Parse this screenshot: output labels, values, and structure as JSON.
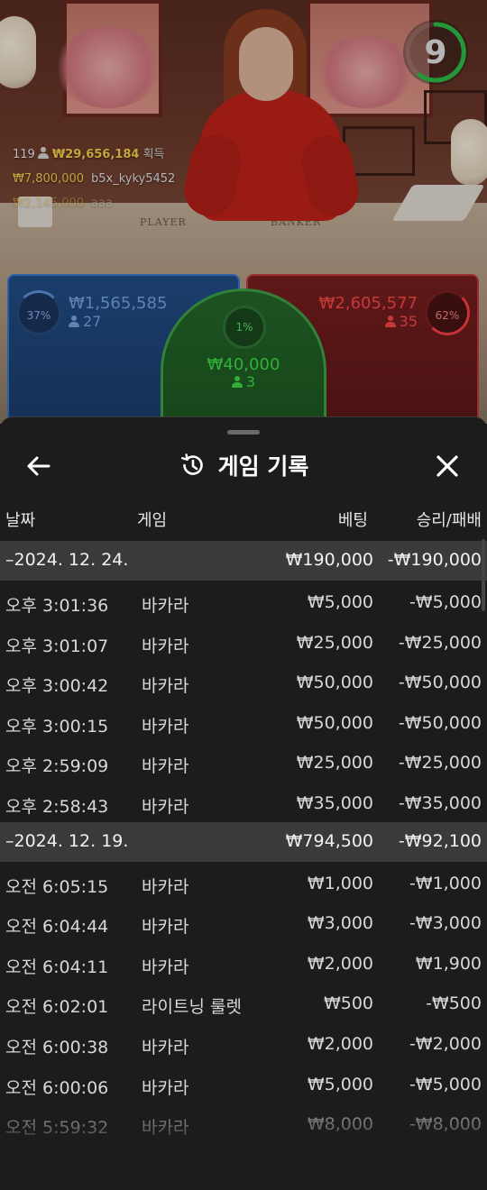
{
  "video": {
    "timer": "9",
    "felt_player": "PLAYER",
    "felt_banker": "BANKER",
    "winners": [
      {
        "count": "119",
        "amount": "₩29,656,184",
        "label": "획득"
      },
      {
        "amount": "₩7,800,000",
        "user": "b5x_kyky5452"
      },
      {
        "amount": "₩2,145,000",
        "user": "aaa"
      }
    ]
  },
  "bets": {
    "player": {
      "percent": "37%",
      "amount": "₩1,565,585",
      "players": "27",
      "color": "#3b7ad0"
    },
    "tie": {
      "percent": "1%",
      "amount": "₩40,000",
      "players": "3",
      "color": "#3fa64a"
    },
    "banker": {
      "percent": "62%",
      "amount": "₩2,605,577",
      "players": "35",
      "color": "#c83a3a"
    }
  },
  "history": {
    "title": "게임 기록",
    "columns": {
      "date": "날짜",
      "game": "게임",
      "bet": "베팅",
      "result": "승리/패배"
    },
    "groups": [
      {
        "date": "–2024. 12. 24.",
        "bet": "₩190,000",
        "result": "-₩190,000",
        "items": [
          {
            "time": "오후 3:01:36",
            "game": "바카라",
            "bet": "₩5,000",
            "result": "-₩5,000"
          },
          {
            "time": "오후 3:01:07",
            "game": "바카라",
            "bet": "₩25,000",
            "result": "-₩25,000"
          },
          {
            "time": "오후 3:00:42",
            "game": "바카라",
            "bet": "₩50,000",
            "result": "-₩50,000"
          },
          {
            "time": "오후 3:00:15",
            "game": "바카라",
            "bet": "₩50,000",
            "result": "-₩50,000"
          },
          {
            "time": "오후 2:59:09",
            "game": "바카라",
            "bet": "₩25,000",
            "result": "-₩25,000"
          },
          {
            "time": "오후 2:58:43",
            "game": "바카라",
            "bet": "₩35,000",
            "result": "-₩35,000"
          }
        ]
      },
      {
        "date": "–2024. 12. 19.",
        "bet": "₩794,500",
        "result": "-₩92,100",
        "items": [
          {
            "time": "오전 6:05:15",
            "game": "바카라",
            "bet": "₩1,000",
            "result": "-₩1,000"
          },
          {
            "time": "오전 6:04:44",
            "game": "바카라",
            "bet": "₩3,000",
            "result": "-₩3,000"
          },
          {
            "time": "오전 6:04:11",
            "game": "바카라",
            "bet": "₩2,000",
            "result": "₩1,900"
          },
          {
            "time": "오전 6:02:01",
            "game": "라이트닝 룰렛",
            "bet": "₩500",
            "result": "-₩500"
          },
          {
            "time": "오전 6:00:38",
            "game": "바카라",
            "bet": "₩2,000",
            "result": "-₩2,000"
          },
          {
            "time": "오전 6:00:06",
            "game": "바카라",
            "bet": "₩5,000",
            "result": "-₩5,000"
          },
          {
            "time": "오전 5:59:32",
            "game": "바카라",
            "bet": "₩8,000",
            "result": "-₩8,000"
          }
        ]
      }
    ]
  },
  "icons": {
    "back": "arrow-left-icon",
    "history": "history-clock-icon",
    "close": "close-icon",
    "person": "person-icon"
  }
}
